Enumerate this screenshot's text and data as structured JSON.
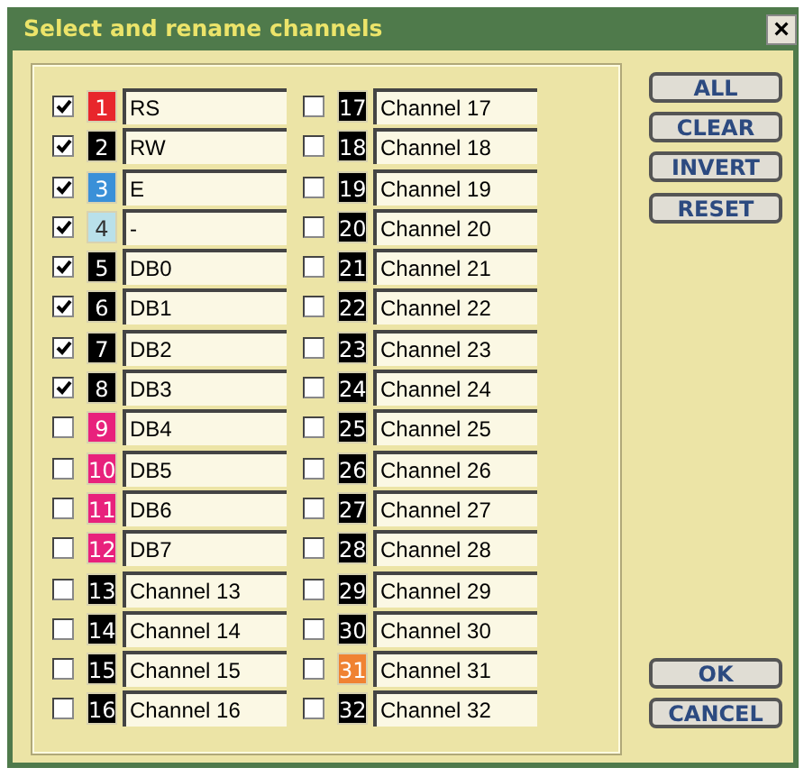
{
  "window": {
    "title": "Select and rename channels",
    "close": "×"
  },
  "channels": [
    {
      "number": "1",
      "name": "RS",
      "checked": true,
      "color": "#e8262c"
    },
    {
      "number": "2",
      "name": "RW",
      "checked": true,
      "color": "#000000"
    },
    {
      "number": "3",
      "name": "E",
      "checked": true,
      "color": "#3a90d8"
    },
    {
      "number": "4",
      "name": "-",
      "checked": true,
      "color": "#b9e0ea"
    },
    {
      "number": "5",
      "name": "DB0",
      "checked": true,
      "color": "#000000"
    },
    {
      "number": "6",
      "name": "DB1",
      "checked": true,
      "color": "#000000"
    },
    {
      "number": "7",
      "name": "DB2",
      "checked": true,
      "color": "#000000"
    },
    {
      "number": "8",
      "name": "DB3",
      "checked": true,
      "color": "#000000"
    },
    {
      "number": "9",
      "name": "DB4",
      "checked": false,
      "color": "#e8217c"
    },
    {
      "number": "10",
      "name": "DB5",
      "checked": false,
      "color": "#e8217c"
    },
    {
      "number": "11",
      "name": "DB6",
      "checked": false,
      "color": "#e8217c"
    },
    {
      "number": "12",
      "name": "DB7",
      "checked": false,
      "color": "#e8217c"
    },
    {
      "number": "13",
      "name": "Channel 13",
      "checked": false,
      "color": "#000000"
    },
    {
      "number": "14",
      "name": "Channel 14",
      "checked": false,
      "color": "#000000"
    },
    {
      "number": "15",
      "name": "Channel 15",
      "checked": false,
      "color": "#000000"
    },
    {
      "number": "16",
      "name": "Channel 16",
      "checked": false,
      "color": "#000000"
    },
    {
      "number": "17",
      "name": "Channel 17",
      "checked": false,
      "color": "#000000"
    },
    {
      "number": "18",
      "name": "Channel 18",
      "checked": false,
      "color": "#000000"
    },
    {
      "number": "19",
      "name": "Channel 19",
      "checked": false,
      "color": "#000000"
    },
    {
      "number": "20",
      "name": "Channel 20",
      "checked": false,
      "color": "#000000"
    },
    {
      "number": "21",
      "name": "Channel 21",
      "checked": false,
      "color": "#000000"
    },
    {
      "number": "22",
      "name": "Channel 22",
      "checked": false,
      "color": "#000000"
    },
    {
      "number": "23",
      "name": "Channel 23",
      "checked": false,
      "color": "#000000"
    },
    {
      "number": "24",
      "name": "Channel 24",
      "checked": false,
      "color": "#000000"
    },
    {
      "number": "25",
      "name": "Channel 25",
      "checked": false,
      "color": "#000000"
    },
    {
      "number": "26",
      "name": "Channel 26",
      "checked": false,
      "color": "#000000"
    },
    {
      "number": "27",
      "name": "Channel 27",
      "checked": false,
      "color": "#000000"
    },
    {
      "number": "28",
      "name": "Channel 28",
      "checked": false,
      "color": "#000000"
    },
    {
      "number": "29",
      "name": "Channel 29",
      "checked": false,
      "color": "#000000"
    },
    {
      "number": "30",
      "name": "Channel 30",
      "checked": false,
      "color": "#000000"
    },
    {
      "number": "31",
      "name": "Channel 31",
      "checked": false,
      "color": "#f08232"
    },
    {
      "number": "32",
      "name": "Channel 32",
      "checked": false,
      "color": "#000000"
    }
  ],
  "top_buttons": [
    "ALL",
    "CLEAR",
    "INVERT",
    "RESET"
  ],
  "bottom_buttons": [
    "OK",
    "CANCEL"
  ]
}
